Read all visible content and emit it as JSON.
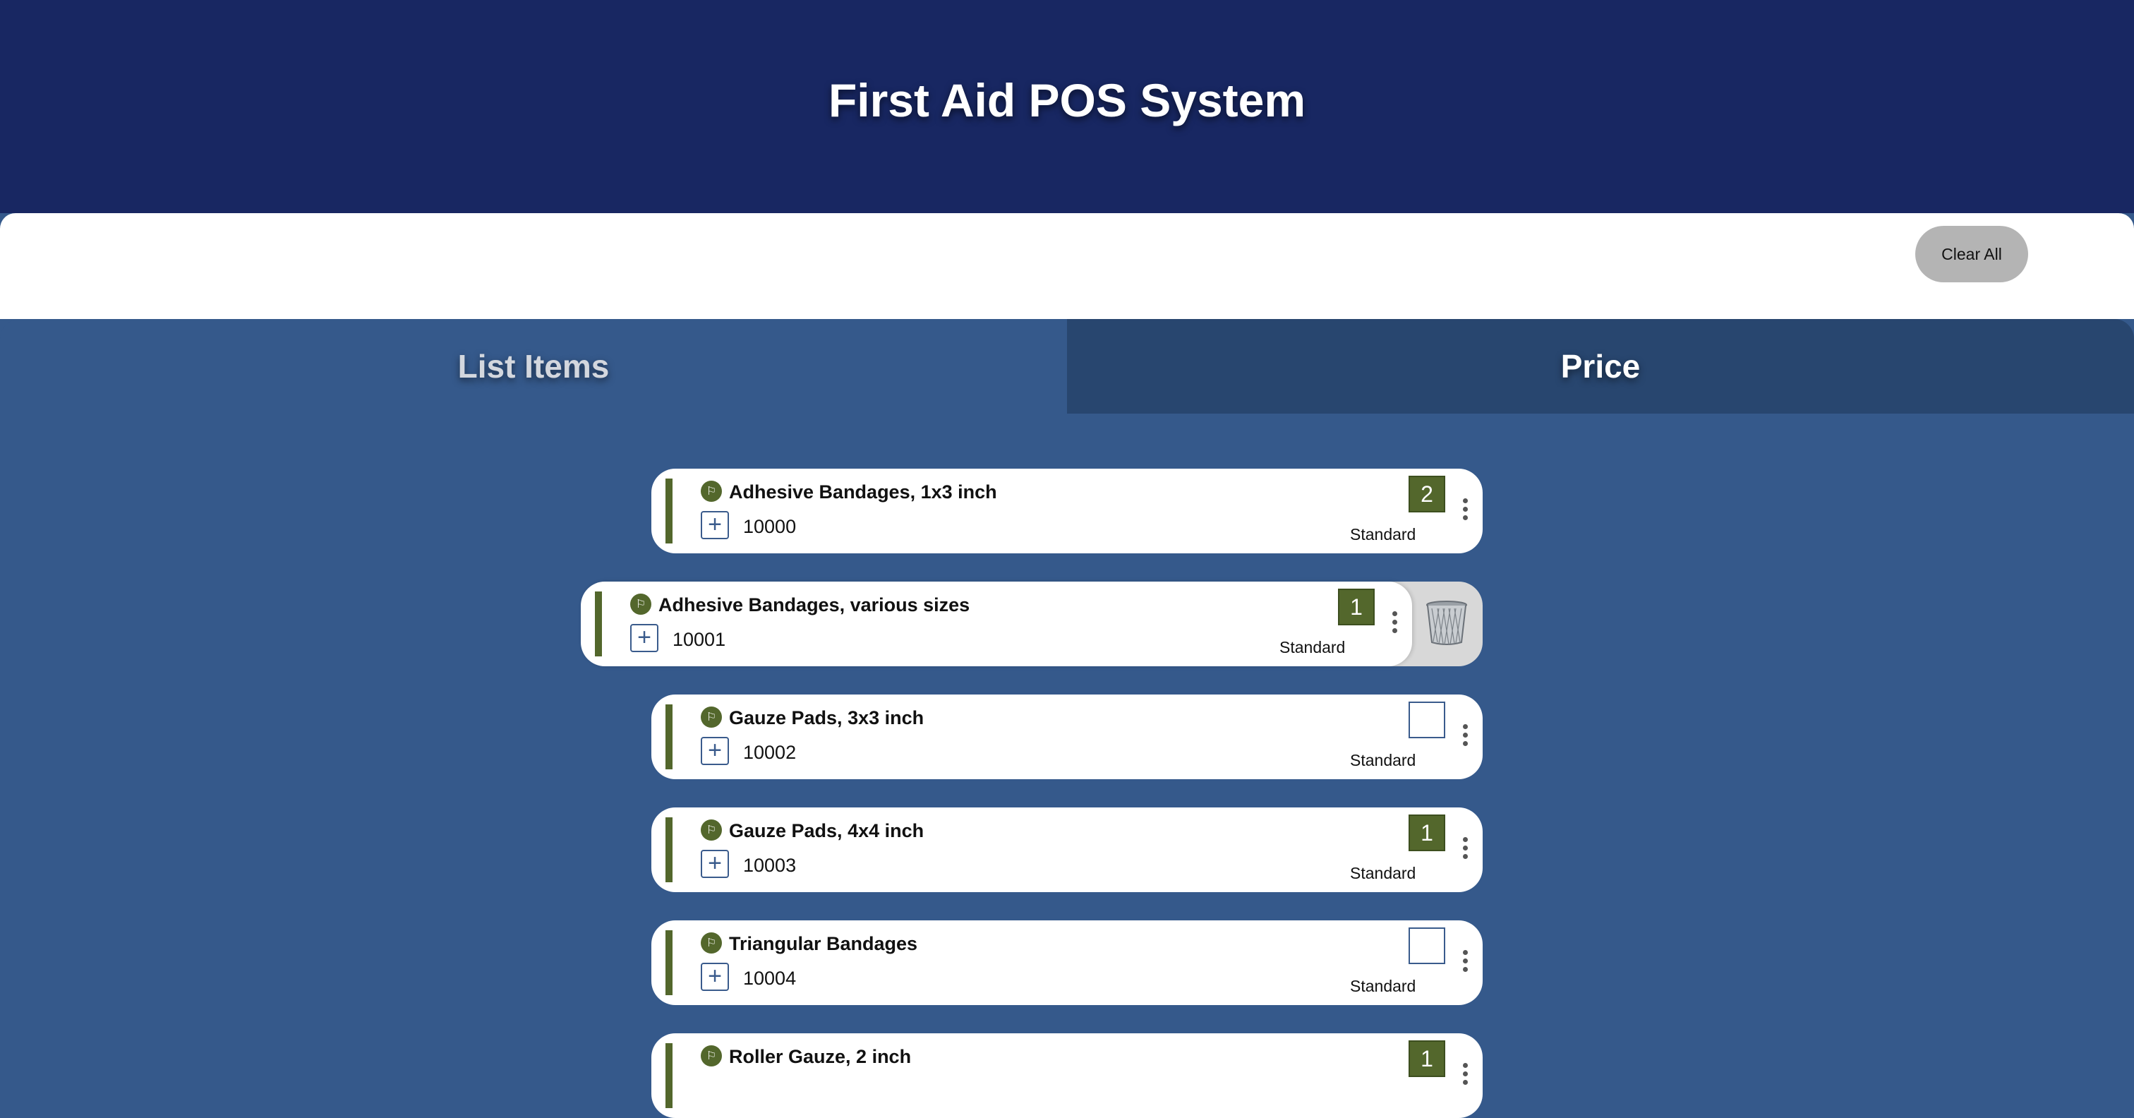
{
  "header": {
    "title": "First Aid POS System"
  },
  "toolbar": {
    "clear_label": "Clear All"
  },
  "tabs": [
    {
      "label": "List Items"
    },
    {
      "label": "Price"
    }
  ],
  "colors": {
    "header_bg": "#182762",
    "page_bg": "#35598b",
    "accent_green": "#53672c"
  },
  "items": [
    {
      "name": "Adhesive Bandages, 1x3 inch",
      "code": "10000",
      "qty": "2",
      "type": "Standard"
    },
    {
      "name": "Adhesive Bandages, various sizes",
      "code": "10001",
      "qty": "1",
      "type": "Standard"
    },
    {
      "name": "Gauze Pads, 3x3 inch",
      "code": "10002",
      "qty": "",
      "type": "Standard"
    },
    {
      "name": "Gauze Pads, 4x4 inch",
      "code": "10003",
      "qty": "1",
      "type": "Standard"
    },
    {
      "name": "Triangular Bandages",
      "code": "10004",
      "qty": "",
      "type": "Standard"
    },
    {
      "name": "Roller Gauze, 2 inch",
      "code": "",
      "qty": "1",
      "type": ""
    }
  ],
  "icons": {
    "flag": "flag-icon",
    "add": "plus-icon",
    "menu": "more-vertical-icon",
    "delete": "trash-icon"
  }
}
